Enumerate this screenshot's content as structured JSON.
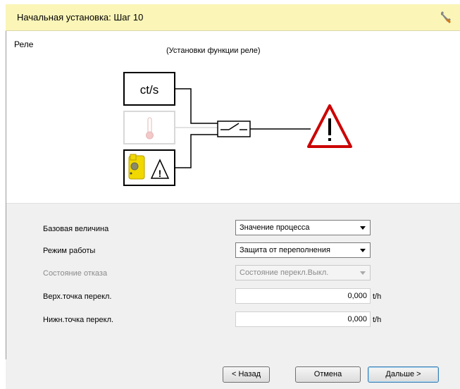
{
  "header": {
    "title": "Начальная установка: Шаг 10",
    "icon": "wrench-icon"
  },
  "section": {
    "title": "Реле",
    "subtitle": "(Установки функции реле)"
  },
  "diagram": {
    "input_label": "ct/s"
  },
  "form": {
    "base_value": {
      "label": "Базовая величина",
      "value": "Значение процесса"
    },
    "mode": {
      "label": "Режим работы",
      "value": "Защита от переполнения"
    },
    "fault_state": {
      "label": "Состояние отказа",
      "value": "Состояние перекл.Выкл."
    },
    "upper_point": {
      "label": "Верх.точка перекл.",
      "value": "0,000",
      "unit": "t/h"
    },
    "lower_point": {
      "label": "Нижн.точка перекл.",
      "value": "0,000",
      "unit": "t/h"
    }
  },
  "buttons": {
    "back": "< Назад",
    "cancel": "Отмена",
    "next": "Дальше >"
  },
  "colors": {
    "header_bg": "#fbf5b8",
    "warning_red": "#cc0000",
    "sensor_yellow": "#f0d800"
  }
}
